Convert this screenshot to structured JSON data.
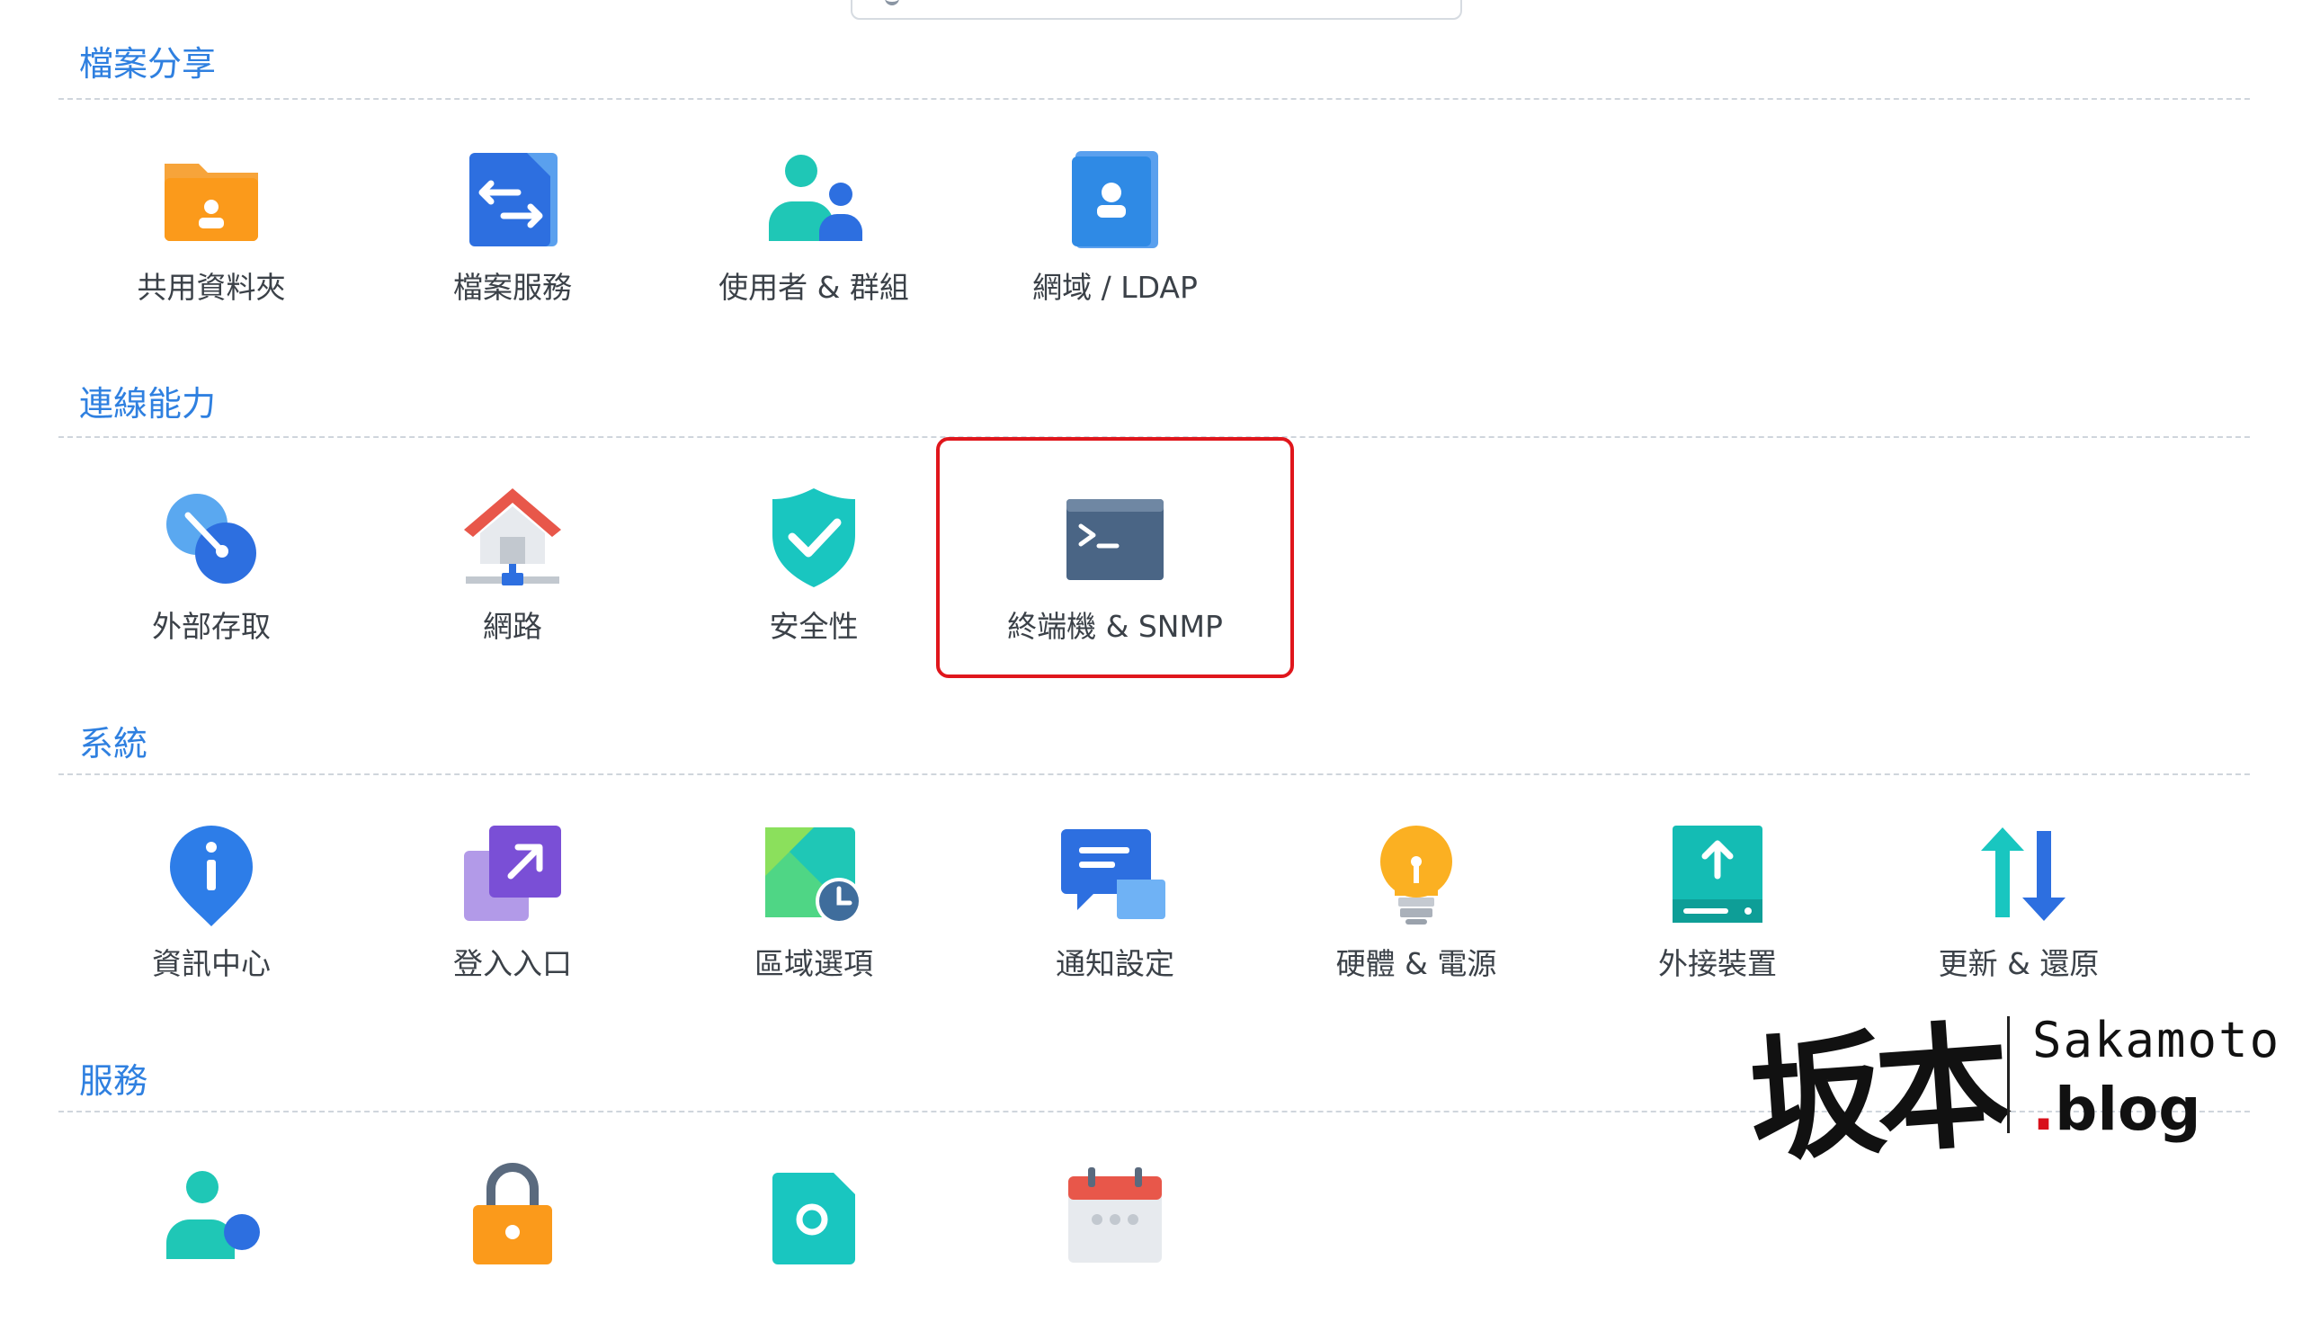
{
  "sections": [
    {
      "title": "檔案分享",
      "items": [
        {
          "label": "共用資料夾",
          "icon": "shared-folder-icon"
        },
        {
          "label": "檔案服務",
          "icon": "file-services-icon"
        },
        {
          "label": "使用者 & 群組",
          "icon": "users-groups-icon"
        },
        {
          "label": "網域 / LDAP",
          "icon": "domain-ldap-icon"
        }
      ]
    },
    {
      "title": "連線能力",
      "items": [
        {
          "label": "外部存取",
          "icon": "external-access-icon"
        },
        {
          "label": "網路",
          "icon": "network-icon"
        },
        {
          "label": "安全性",
          "icon": "security-icon"
        },
        {
          "label": "終端機 & SNMP",
          "icon": "terminal-icon"
        }
      ]
    },
    {
      "title": "系統",
      "items": [
        {
          "label": "資訊中心",
          "icon": "info-center-icon"
        },
        {
          "label": "登入入口",
          "icon": "login-portal-icon"
        },
        {
          "label": "區域選項",
          "icon": "regional-options-icon"
        },
        {
          "label": "通知設定",
          "icon": "notification-icon"
        },
        {
          "label": "硬體 & 電源",
          "icon": "hardware-power-icon"
        },
        {
          "label": "外接裝置",
          "icon": "external-devices-icon"
        },
        {
          "label": "更新 & 還原",
          "icon": "update-restore-icon"
        }
      ]
    },
    {
      "title": "服務",
      "items": [
        {
          "icon": "synology-account-icon"
        },
        {
          "icon": "application-privileges-icon"
        },
        {
          "icon": "indexing-service-icon"
        },
        {
          "icon": "task-scheduler-icon"
        }
      ]
    }
  ],
  "highlighted_item": "終端機 & SNMP",
  "watermark": {
    "cjk": "坂本",
    "line1": "Sakamoto",
    "dot": ".",
    "line2": "blog"
  },
  "colors": {
    "accent": "#2f80e0",
    "highlight": "#e0161c"
  }
}
